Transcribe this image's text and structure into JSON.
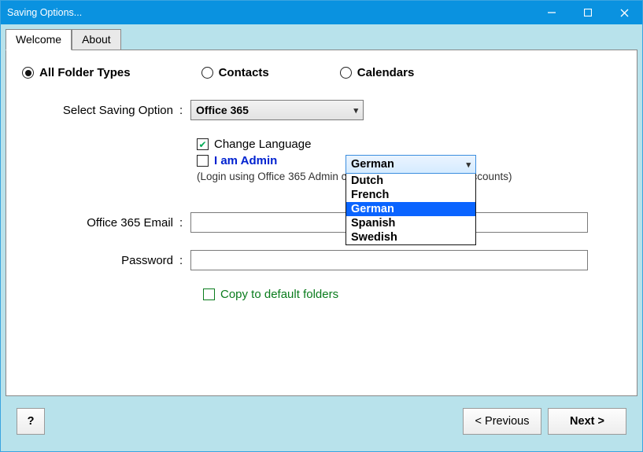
{
  "window": {
    "title": "Saving Options..."
  },
  "tabs": {
    "welcome": "Welcome",
    "about": "About"
  },
  "folder_type": {
    "all": "All Folder Types",
    "contacts": "Contacts",
    "calendars": "Calendars",
    "selected": "all"
  },
  "saving_option": {
    "label": "Select Saving Option",
    "value": "Office 365"
  },
  "change_language": {
    "label": "Change Language",
    "checked": true,
    "selected": "German",
    "options": [
      "Dutch",
      "French",
      "German",
      "Spanish",
      "Swedish"
    ]
  },
  "admin": {
    "label": "I am Admin",
    "checked": false,
    "note": "(Login using Office 365 Admin credentials to export User Accounts)"
  },
  "email": {
    "label": "Office 365 Email",
    "value": ""
  },
  "password": {
    "label": "Password",
    "value": ""
  },
  "copy_default": {
    "label": "Copy to default folders",
    "checked": false
  },
  "footer": {
    "help": "?",
    "previous": "<  Previous",
    "next": "Next  >"
  }
}
